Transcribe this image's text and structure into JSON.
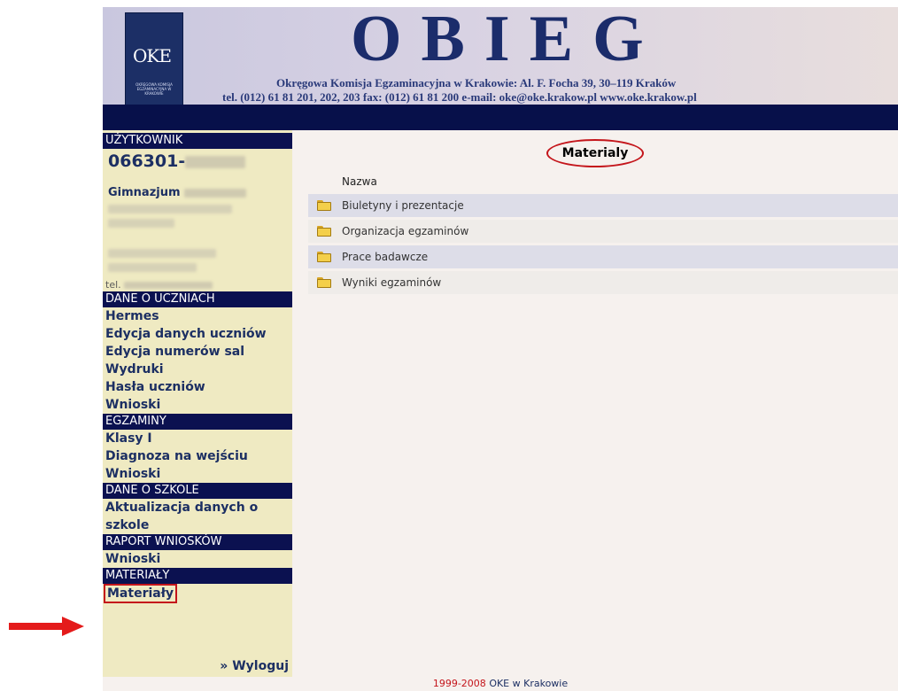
{
  "header": {
    "title": "OBIEG",
    "address_line1": "Okręgowa Komisja Egzaminacyjna w Krakowie:  Al. F. Focha 39, 30–119 Kraków",
    "address_line2": "tel. (012) 61 81 201, 202, 203  fax: (012) 61 81 200  e-mail: oke@oke.krakow.pl   www.oke.krakow.pl",
    "logo_glyph": "OKE",
    "logo_text": "OKRĘGOWA KOMISJA EGZAMINACYJNA W KRAKOWIE"
  },
  "sidebar": {
    "user_section": "UŻYTKOWNIK",
    "user_id": "066301-",
    "school_prefix": "Gimnazjum",
    "tel_label": "tel.",
    "sections": [
      {
        "title": "DANE O UCZNIACH",
        "items": [
          "Hermes",
          "Edycja danych uczniów",
          "Edycja numerów sal",
          "Wydruki",
          "Hasła uczniów",
          "Wnioski"
        ]
      },
      {
        "title": "EGZAMINY",
        "items": [
          "Klasy I",
          "Diagnoza na wejściu",
          "Wnioski"
        ]
      },
      {
        "title": "DANE O SZKOLE",
        "items": [
          "Aktualizacja danych o",
          "szkole"
        ]
      },
      {
        "title": "RAPORT WNIOSKÓW",
        "items": [
          "Wnioski"
        ]
      },
      {
        "title": "MATERIAŁY",
        "items": [
          "Materiały"
        ]
      }
    ],
    "logout": "» Wyloguj"
  },
  "main": {
    "title": "Materialy",
    "column_header": "Nazwa",
    "folders": [
      "Biuletyny i prezentacje",
      "Organizacja egzaminów",
      "Prace badawcze",
      "Wyniki egzaminów"
    ]
  },
  "footer": {
    "years": "1999-2008",
    "org": "OKE w Krakowie"
  },
  "colors": {
    "accent_navy": "#07104a",
    "sidebar_bg": "#efeac2",
    "highlight_red": "#c4151b",
    "link_blue": "#1c2f63"
  }
}
